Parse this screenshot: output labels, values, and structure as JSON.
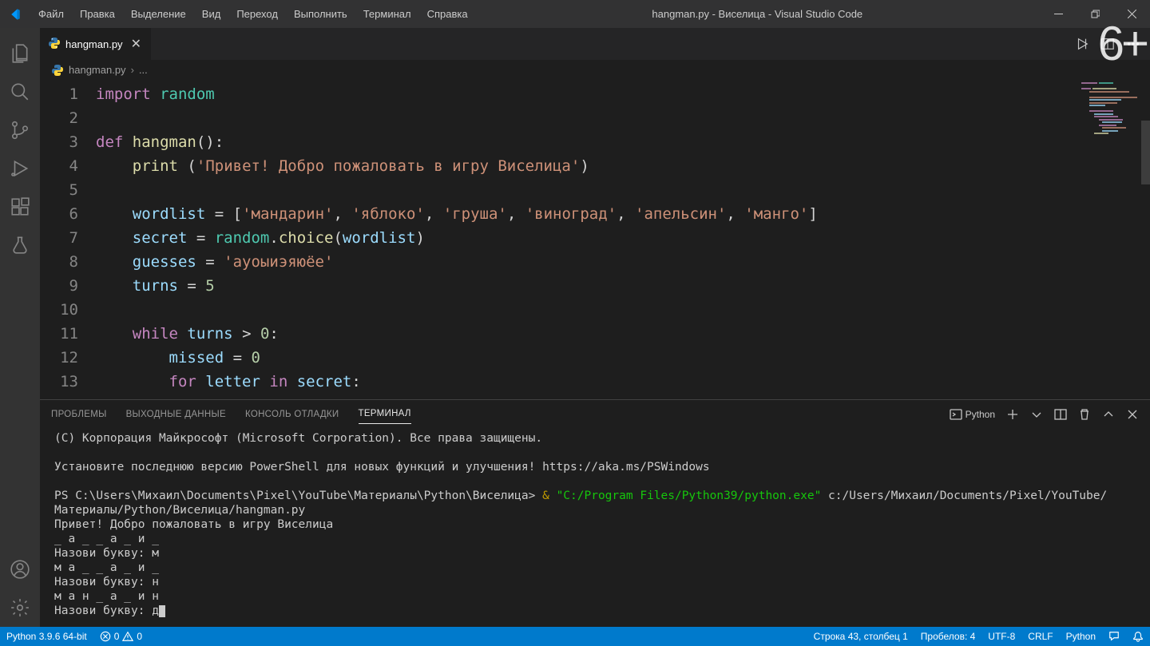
{
  "menubar": {
    "items": [
      "Файл",
      "Правка",
      "Выделение",
      "Вид",
      "Переход",
      "Выполнить",
      "Терминал",
      "Справка"
    ]
  },
  "window": {
    "title": "hangman.py - Виселица - Visual Studio Code"
  },
  "age_badge": "6+",
  "tab": {
    "label": "hangman.py"
  },
  "breadcrumb": {
    "file": "hangman.py",
    "rest": "..."
  },
  "gutter": [
    "1",
    "2",
    "3",
    "4",
    "5",
    "6",
    "7",
    "8",
    "9",
    "10",
    "11",
    "12",
    "13"
  ],
  "code": {
    "l1_kw": "import",
    "l1_mod": " random",
    "l3_kw": "def",
    "l3_fn": " hangman",
    "l3_punc": "():",
    "l4_fn": "print",
    "l4_space": " ",
    "l4_p1": "(",
    "l4_str": "'Привет! Добро пожаловать в игру Виселица'",
    "l4_p2": ")",
    "l6_var": "wordlist",
    "l6_eq": " = ",
    "l6_b1": "[",
    "l6_s1": "'мандарин'",
    "l6_c": ", ",
    "l6_s2": "'яблоко'",
    "l6_s3": "'груша'",
    "l6_s4": "'виноград'",
    "l6_s5": "'апельсин'",
    "l6_s6": "'манго'",
    "l6_b2": "]",
    "l7_var": "secret",
    "l7_eq": " = ",
    "l7_mod": "random",
    "l7_dot": ".",
    "l7_fn": "choice",
    "l7_p1": "(",
    "l7_arg": "wordlist",
    "l7_p2": ")",
    "l8_var": "guesses",
    "l8_eq": " = ",
    "l8_str": "'ауоыиэяюёе'",
    "l9_var": "turns",
    "l9_eq": " = ",
    "l9_num": "5",
    "l11_kw": "while",
    "l11_sp": " ",
    "l11_var": "turns",
    "l11_op": " > ",
    "l11_num": "0",
    "l11_col": ":",
    "l12_var": "missed",
    "l12_eq": " = ",
    "l12_num": "0",
    "l13_kw1": "for",
    "l13_sp1": " ",
    "l13_var1": "letter",
    "l13_sp2": " ",
    "l13_kw2": "in",
    "l13_sp3": " ",
    "l13_var2": "secret",
    "l13_col": ":"
  },
  "panel": {
    "tabs": [
      "ПРОБЛЕМЫ",
      "ВЫХОДНЫЕ ДАННЫЕ",
      "КОНСОЛЬ ОТЛАДКИ",
      "ТЕРМИНАЛ"
    ],
    "terminal_type": "Python"
  },
  "terminal": {
    "l1": "(C) Корпорация Майкрософт (Microsoft Corporation). Все права защищены.",
    "l3": "Установите последнюю версию PowerShell для новых функций и улучшения! https://aka.ms/PSWindows",
    "l5_prefix": "PS C:\\Users\\Михаил\\Documents\\Pixel\\YouTube\\Материалы\\Python\\Виселица> ",
    "l5_amp": "& ",
    "l5_exe": "\"C:/Program Files/Python39/python.exe\"",
    "l5_rest": " c:/Users/Михаил/Documents/Pixel/YouTube/Материалы/Python/Виселица/hangman.py",
    "l6": "Привет! Добро пожаловать в игру Виселица",
    "l7": "_ а _ _ а _ и _",
    "l8": "Назови букву: м",
    "l9": "м а _ _ а _ и _",
    "l10": "Назови букву: н",
    "l11": "м а н _ а _ и н",
    "l12": "Назови букву: д"
  },
  "status": {
    "python": "Python 3.9.6 64-bit",
    "errors": "0",
    "warnings": "0",
    "position": "Строка 43, столбец 1",
    "spaces": "Пробелов: 4",
    "encoding": "UTF-8",
    "eol": "CRLF",
    "lang": "Python"
  }
}
